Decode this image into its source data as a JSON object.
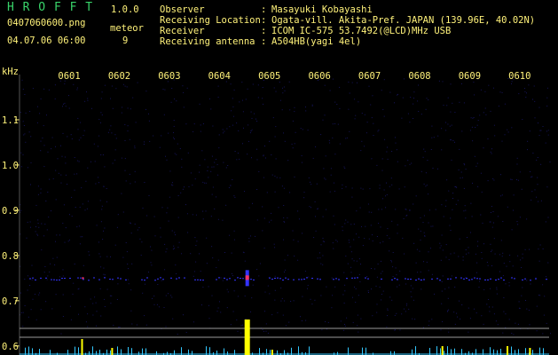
{
  "app": {
    "name": "H R O F F T",
    "version": "1.0.0"
  },
  "file": {
    "name": "0407060600.png",
    "datetime": "04.07.06 06:00"
  },
  "meteor": {
    "label": "meteor",
    "count": "9"
  },
  "station": [
    {
      "label": "Observer",
      "value": "Masayuki Kobayashi"
    },
    {
      "label": "Receiving Location",
      "value": "Ogata-vill. Akita-Pref. JAPAN (139.96E, 40.02N)"
    },
    {
      "label": "Receiver",
      "value": "ICOM IC-575 53.7492(@LCD)MHz USB"
    },
    {
      "label": "Receiving antenna",
      "value": "A504HB(yagi 4el)"
    }
  ],
  "separator": ":",
  "colors": {
    "text": "#fff27a",
    "title": "#39d46a",
    "background": "#000000",
    "noise": "#16145a",
    "signal": "#3333ff",
    "echo": "#ff3366",
    "peak": "#ffff00",
    "baseline": "#33c8ff"
  },
  "chart_data": {
    "type": "heatmap",
    "ylabel": "kHz",
    "ylim": [
      0.58,
      1.2
    ],
    "yticks": [
      {
        "value": 1.1,
        "label": "1.1"
      },
      {
        "value": 1.0,
        "label": "1.0"
      },
      {
        "value": 0.9,
        "label": "0.9"
      },
      {
        "value": 0.8,
        "label": "0.8"
      },
      {
        "value": 0.7,
        "label": "0.7"
      },
      {
        "value": 0.6,
        "label": "0.6"
      }
    ],
    "x_range": [
      0,
      10.6
    ],
    "xticks": [
      {
        "value": 1,
        "label": "0601"
      },
      {
        "value": 2,
        "label": "0602"
      },
      {
        "value": 3,
        "label": "0603"
      },
      {
        "value": 4,
        "label": "0604"
      },
      {
        "value": 5,
        "label": "0605"
      },
      {
        "value": 6,
        "label": "0606"
      },
      {
        "value": 7,
        "label": "0607"
      },
      {
        "value": 8,
        "label": "0608"
      },
      {
        "value": 9,
        "label": "0609"
      },
      {
        "value": 10,
        "label": "0610"
      }
    ],
    "carrier_khz": 0.75,
    "meteor_echo": {
      "time": 4.55,
      "khz": 0.75
    },
    "echo_count_peaks": [
      {
        "time": 1.25,
        "strength": 0.45
      },
      {
        "time": 1.85,
        "strength": 0.2
      },
      {
        "time": 4.55,
        "strength": 1.0
      },
      {
        "time": 5.05,
        "strength": 0.15
      },
      {
        "time": 8.45,
        "strength": 0.25
      },
      {
        "time": 9.75,
        "strength": 0.25
      },
      {
        "time": 10.2,
        "strength": 0.2
      }
    ]
  }
}
